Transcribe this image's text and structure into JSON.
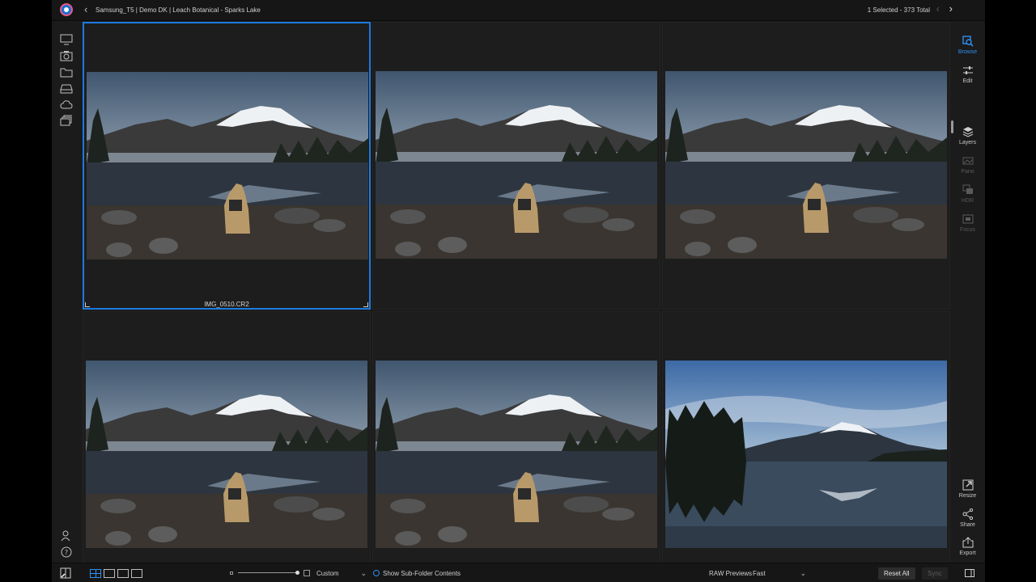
{
  "header": {
    "breadcrumb": "Samsung_T5 | Demo DK | Leach Botanical - Sparks Lake",
    "counter": "1 Selected - 373 Total"
  },
  "left_rail": {
    "items": [
      {
        "name": "monitor-icon"
      },
      {
        "name": "camera-icon"
      },
      {
        "name": "folder-icon"
      },
      {
        "name": "drive-icon"
      },
      {
        "name": "cloud-icon"
      },
      {
        "name": "albums-icon"
      }
    ],
    "bottom": [
      {
        "name": "user-icon"
      },
      {
        "name": "help-icon"
      }
    ]
  },
  "grid": {
    "items": [
      {
        "filename": "IMG_0510.CR2",
        "selected": true,
        "scene": "dog"
      },
      {
        "filename": "",
        "selected": false,
        "scene": "dog"
      },
      {
        "filename": "",
        "selected": false,
        "scene": "dog"
      },
      {
        "filename": "",
        "selected": false,
        "scene": "dog"
      },
      {
        "filename": "",
        "selected": false,
        "scene": "dog"
      },
      {
        "filename": "",
        "selected": false,
        "scene": "lake"
      }
    ]
  },
  "right_rail": {
    "browse": "Browse",
    "edit": "Edit",
    "layers": "Layers",
    "pano": "Pano",
    "hdr": "HDR",
    "focus": "Focus",
    "resize": "Resize",
    "share": "Share",
    "export": "Export"
  },
  "bottombar": {
    "sort": "Custom",
    "subfolder": "Show Sub-Folder Contents",
    "raw_label": "RAW Previews",
    "raw_value": "Fast",
    "reset_all": "Reset All",
    "sync": "Sync"
  },
  "colors": {
    "accent": "#2f8ef0",
    "selection": "#1e7ae0",
    "background": "#1b1b1b"
  }
}
